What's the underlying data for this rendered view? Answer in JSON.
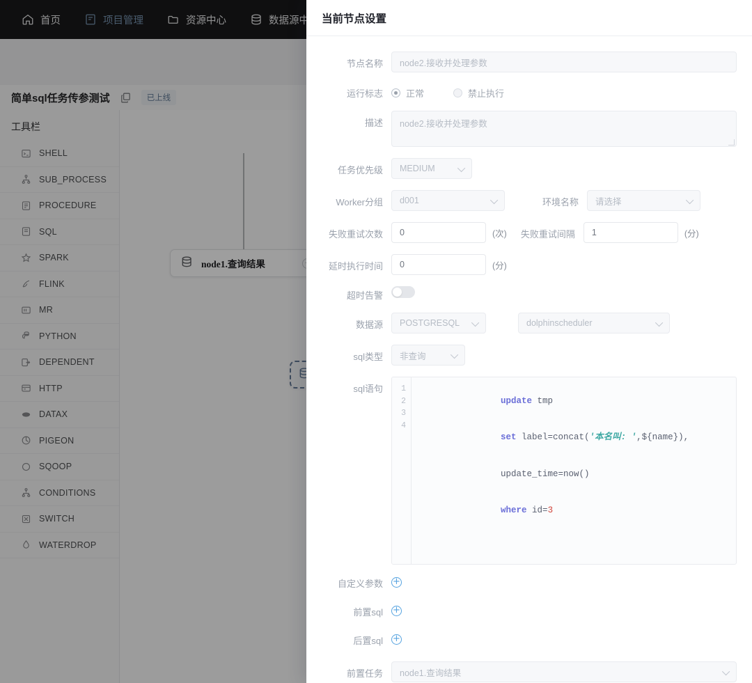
{
  "topnav": {
    "items": [
      {
        "label": "首页",
        "icon": "home-icon",
        "active": false
      },
      {
        "label": "项目管理",
        "icon": "project-icon",
        "active": true
      },
      {
        "label": "资源中心",
        "icon": "folder-icon",
        "active": false
      },
      {
        "label": "数据源中心",
        "icon": "database-icon",
        "active": false
      },
      {
        "label": "",
        "icon": "monitor-icon",
        "active": false
      }
    ],
    "active_color": "#4a9bf0"
  },
  "workflow_header": {
    "title": "简单sql任务传参测试",
    "copy_icon": "copy-icon",
    "status_badge": "已上线",
    "badge_color": "#3a7fd0"
  },
  "toolbar": {
    "title": "工具栏",
    "items": [
      {
        "label": "SHELL",
        "icon": "shell-icon"
      },
      {
        "label": "SUB_PROCESS",
        "icon": "sub-process-icon"
      },
      {
        "label": "PROCEDURE",
        "icon": "procedure-icon"
      },
      {
        "label": "SQL",
        "icon": "sql-icon"
      },
      {
        "label": "SPARK",
        "icon": "spark-icon"
      },
      {
        "label": "FLINK",
        "icon": "flink-icon"
      },
      {
        "label": "MR",
        "icon": "mr-icon"
      },
      {
        "label": "PYTHON",
        "icon": "python-icon"
      },
      {
        "label": "DEPENDENT",
        "icon": "dependent-icon"
      },
      {
        "label": "HTTP",
        "icon": "http-icon"
      },
      {
        "label": "DATAX",
        "icon": "datax-icon"
      },
      {
        "label": "PIGEON",
        "icon": "pigeon-icon"
      },
      {
        "label": "SQOOP",
        "icon": "sqoop-icon"
      },
      {
        "label": "CONDITIONS",
        "icon": "conditions-icon"
      },
      {
        "label": "SWITCH",
        "icon": "switch-icon"
      },
      {
        "label": "WATERDROP",
        "icon": "waterdrop-icon"
      }
    ]
  },
  "canvas": {
    "nodes": [
      {
        "name": "node1.查询结果",
        "icon": "sql-node-icon",
        "selected": false
      },
      {
        "name": "",
        "icon": "sql-node-icon",
        "selected": true
      }
    ]
  },
  "dialog": {
    "title": "当前节点设置",
    "node_name": {
      "label": "节点名称",
      "value": "node2.接收并处理参数"
    },
    "run_flag": {
      "label": "运行标志",
      "options": [
        {
          "label": "正常",
          "selected": true
        },
        {
          "label": "禁止执行",
          "selected": false
        }
      ]
    },
    "description": {
      "label": "描述",
      "value": "node2.接收并处理参数"
    },
    "priority": {
      "label": "任务优先级",
      "value": "MEDIUM"
    },
    "worker_group": {
      "label": "Worker分组",
      "value": "d001"
    },
    "environment": {
      "label": "环境名称",
      "value": "请选择"
    },
    "retry_times": {
      "label": "失败重试次数",
      "value": "0",
      "unit": "(次)"
    },
    "retry_interval": {
      "label": "失败重试间隔",
      "value": "1",
      "unit": "(分)"
    },
    "delay_time": {
      "label": "延时执行时间",
      "value": "0",
      "unit": "(分)"
    },
    "timeout_alarm": {
      "label": "超时告警",
      "enabled": false
    },
    "datasource": {
      "label": "数据源",
      "type_value": "POSTGRESQL",
      "instance_value": "dolphinscheduler"
    },
    "sql_type": {
      "label": "sql类型",
      "value": "非查询"
    },
    "sql_statement": {
      "label": "sql语句",
      "line_numbers": [
        "1",
        "2",
        "3",
        "4"
      ],
      "lines": [
        {
          "tokens": [
            {
              "t": "update",
              "c": "kw"
            },
            {
              "t": " tmp",
              "c": "plain"
            }
          ]
        },
        {
          "tokens": [
            {
              "t": "set",
              "c": "kw"
            },
            {
              "t": " label=concat(",
              "c": "plain"
            },
            {
              "t": "'本名叫: '",
              "c": "str"
            },
            {
              "t": ",${name}),",
              "c": "plain"
            }
          ]
        },
        {
          "tokens": [
            {
              "t": "update_time=now()",
              "c": "plain"
            }
          ]
        },
        {
          "tokens": [
            {
              "t": "where",
              "c": "kw"
            },
            {
              "t": " id=",
              "c": "plain"
            },
            {
              "t": "3",
              "c": "num"
            }
          ]
        }
      ],
      "plain_text": "update tmp\nset label=concat('本名叫: ',${name}),\nupdate_time=now()\nwhere id=3"
    },
    "custom_params": {
      "label": "自定义参数",
      "add_icon": "plus-circle-icon"
    },
    "pre_sql": {
      "label": "前置sql",
      "add_icon": "plus-circle-icon"
    },
    "post_sql": {
      "label": "后置sql",
      "add_icon": "plus-circle-icon"
    },
    "pre_tasks": {
      "label": "前置任务",
      "value": "node1.查询结果"
    },
    "accent_color": "#56a3e0"
  }
}
